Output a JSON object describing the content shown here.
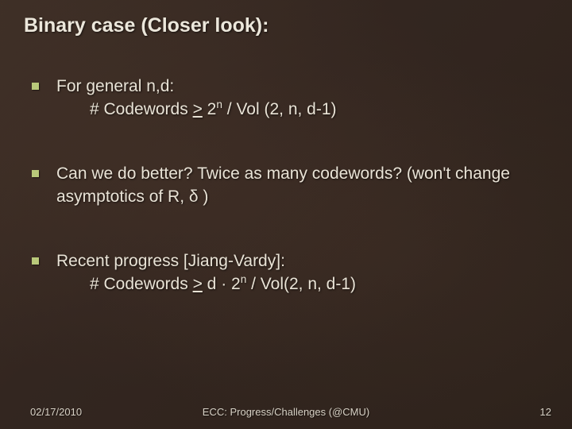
{
  "title": "Binary case (Closer look):",
  "bullets": [
    {
      "line1": "For general n,d:",
      "line2_pre": "# Codewords ",
      "line2_ge": ">",
      "line2_mid": " 2",
      "line2_sup": "n",
      "line2_post": " / Vol (2, n, d-1)"
    },
    {
      "line1": "Can we do better? Twice as many codewords? (won't change asymptotics of R, δ )"
    },
    {
      "line1": "Recent progress [Jiang-Vardy]:",
      "line2_pre": "# Codewords ",
      "line2_ge": ">",
      "line2_mid": " d · 2",
      "line2_sup": "n",
      "line2_post": " / Vol(2, n, d-1)"
    }
  ],
  "footer": {
    "date": "02/17/2010",
    "center": "ECC: Progress/Challenges (@CMU)",
    "page": "12"
  }
}
